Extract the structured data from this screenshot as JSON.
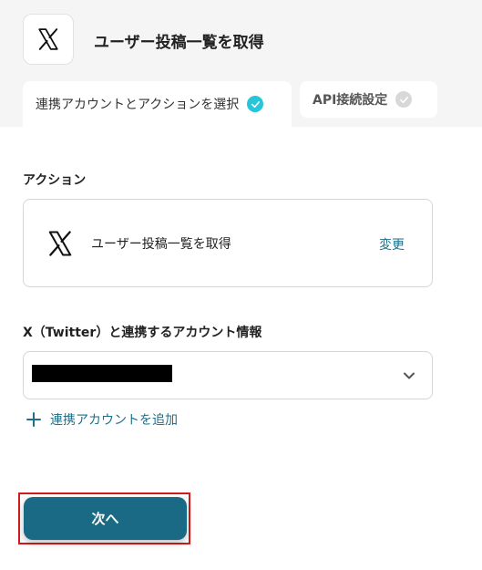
{
  "header": {
    "title": "ユーザー投稿一覧を取得",
    "app_icon": "x-logo-icon"
  },
  "tabs": [
    {
      "label": "連携アカウントとアクションを選択",
      "status": "completed",
      "active": true
    },
    {
      "label": "API接続設定",
      "status": "pending",
      "active": false
    }
  ],
  "action_section": {
    "label": "アクション",
    "card": {
      "icon": "x-logo-icon",
      "text": "ユーザー投稿一覧を取得",
      "change_label": "変更"
    }
  },
  "account_section": {
    "label": "X（Twitter）と連携するアカウント情報",
    "selected_value": "",
    "add_account_label": "連携アカウントを追加"
  },
  "footer": {
    "next_label": "次へ"
  },
  "colors": {
    "accent": "#1a6a85",
    "check_active": "#26c6da",
    "highlight": "#d31b1b"
  }
}
